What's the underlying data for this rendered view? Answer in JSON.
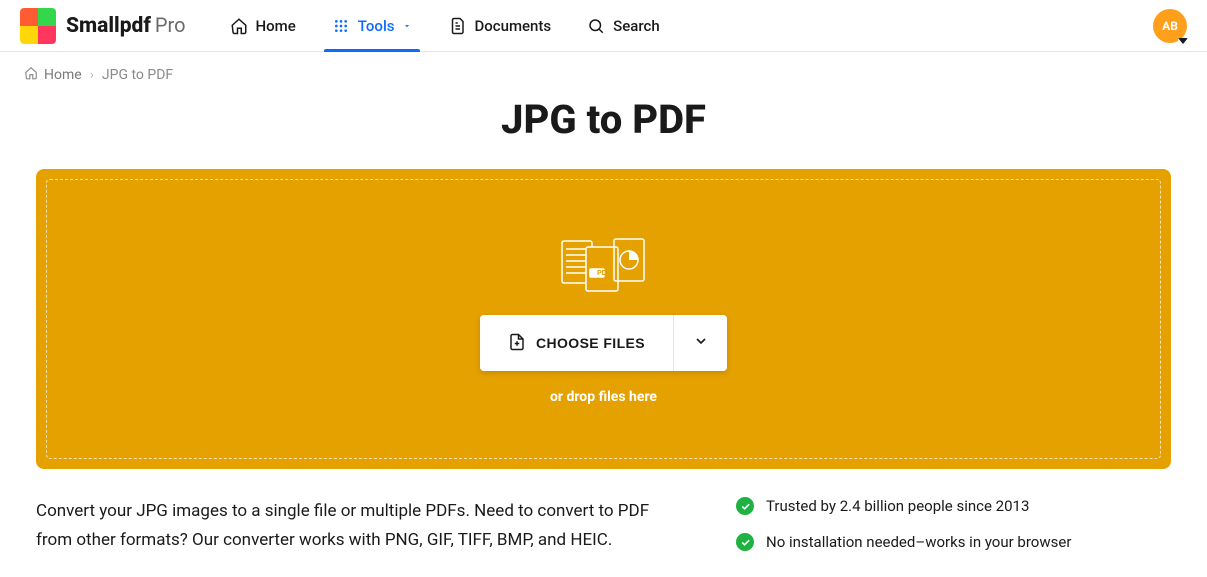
{
  "brand": {
    "name": "Smallpdf",
    "suffix": "Pro"
  },
  "nav": {
    "home": "Home",
    "tools": "Tools",
    "documents": "Documents",
    "search": "Search"
  },
  "avatar": {
    "initials": "AB"
  },
  "breadcrumb": {
    "home": "Home",
    "current": "JPG to PDF"
  },
  "page": {
    "title": "JPG to PDF"
  },
  "dropzone": {
    "choose_label": "CHOOSE FILES",
    "hint": "or drop files here"
  },
  "description": "Convert your JPG images to a single file or multiple PDFs. Need to convert to PDF from other formats? Our converter works with PNG, GIF, TIFF, BMP, and HEIC.",
  "benefits": {
    "b1": "Trusted by 2.4 billion people since 2013",
    "b2": "No installation needed–works in your browser"
  },
  "colors": {
    "accent": "#e5a100",
    "link": "#0f6bff",
    "success": "#1fb141"
  }
}
